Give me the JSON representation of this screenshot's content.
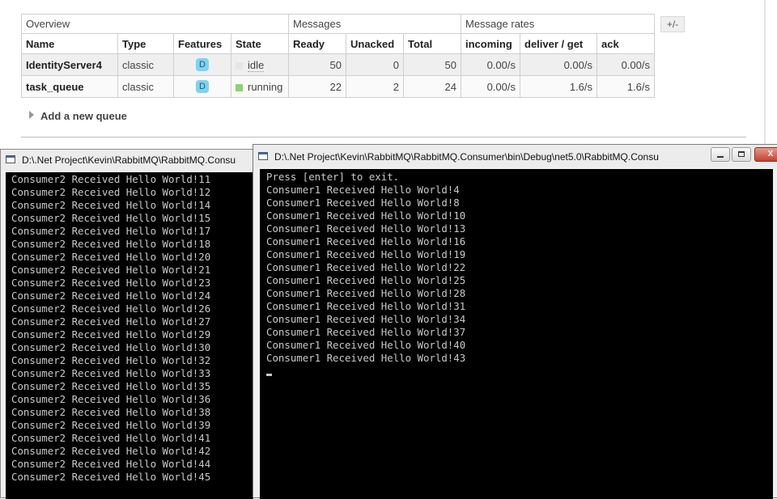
{
  "management": {
    "group_headers": {
      "overview": "Overview",
      "messages": "Messages",
      "message_rates": "Message rates"
    },
    "columns": [
      "Name",
      "Type",
      "Features",
      "State",
      "Ready",
      "Unacked",
      "Total",
      "incoming",
      "deliver / get",
      "ack"
    ],
    "queues": [
      {
        "name": "IdentityServer4",
        "type": "classic",
        "feature": "D",
        "state": "idle",
        "ready": "50",
        "unacked": "0",
        "total": "50",
        "incoming": "0.00/s",
        "deliver_get": "0.00/s",
        "ack": "0.00/s"
      },
      {
        "name": "task_queue",
        "type": "classic",
        "feature": "D",
        "state": "running",
        "ready": "22",
        "unacked": "2",
        "total": "24",
        "incoming": "0.00/s",
        "deliver_get": "1.6/s",
        "ack": "1.6/s"
      }
    ],
    "toggle_columns": "+/-",
    "add_queue": "Add a new queue"
  },
  "colors": {
    "idle": "#e6e6e6",
    "running": "#8ed36d",
    "console_bg": "#000000",
    "console_fg": "#c8c8c8"
  },
  "consumer2_window": {
    "title": "D:\\.Net Project\\Kevin\\RabbitMQ\\RabbitMQ.Consu",
    "lines": [
      "Consumer2 Received Hello World!11",
      "Consumer2 Received Hello World!12",
      "Consumer2 Received Hello World!14",
      "Consumer2 Received Hello World!15",
      "Consumer2 Received Hello World!17",
      "Consumer2 Received Hello World!18",
      "Consumer2 Received Hello World!20",
      "Consumer2 Received Hello World!21",
      "Consumer2 Received Hello World!23",
      "Consumer2 Received Hello World!24",
      "Consumer2 Received Hello World!26",
      "Consumer2 Received Hello World!27",
      "Consumer2 Received Hello World!29",
      "Consumer2 Received Hello World!30",
      "Consumer2 Received Hello World!32",
      "Consumer2 Received Hello World!33",
      "Consumer2 Received Hello World!35",
      "Consumer2 Received Hello World!36",
      "Consumer2 Received Hello World!38",
      "Consumer2 Received Hello World!39",
      "Consumer2 Received Hello World!41",
      "Consumer2 Received Hello World!42",
      "Consumer2 Received Hello World!44",
      "Consumer2 Received Hello World!45"
    ]
  },
  "consumer1_window": {
    "title": "D:\\.Net Project\\Kevin\\RabbitMQ\\RabbitMQ.Consumer\\bin\\Debug\\net5.0\\RabbitMQ.Consu",
    "lines": [
      "Press [enter] to exit.",
      "Consumer1 Received Hello World!4",
      "Consumer1 Received Hello World!8",
      "Consumer1 Received Hello World!10",
      "Consumer1 Received Hello World!13",
      "Consumer1 Received Hello World!16",
      "Consumer1 Received Hello World!19",
      "Consumer1 Received Hello World!22",
      "Consumer1 Received Hello World!25",
      "Consumer1 Received Hello World!28",
      "Consumer1 Received Hello World!31",
      "Consumer1 Received Hello World!34",
      "Consumer1 Received Hello World!37",
      "Consumer1 Received Hello World!40",
      "Consumer1 Received Hello World!43"
    ],
    "controls": {
      "minimize": "minimize-icon",
      "maximize": "maximize-icon",
      "close": "X"
    }
  }
}
